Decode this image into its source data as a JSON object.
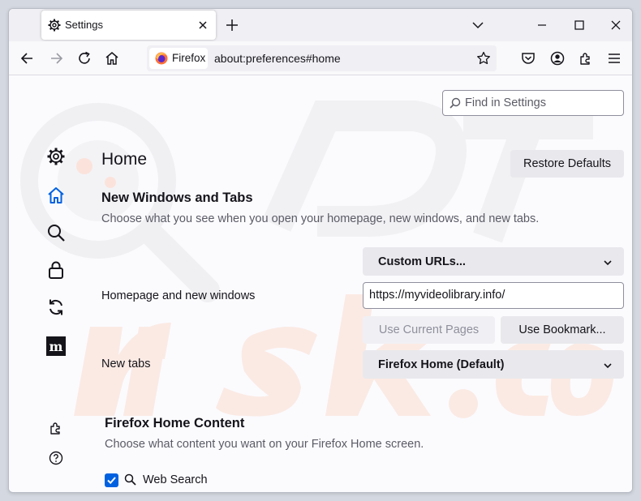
{
  "tab": {
    "title": "Settings"
  },
  "urlbar": {
    "identity_label": "Firefox",
    "url": "about:preferences#home"
  },
  "search": {
    "placeholder": "Find in Settings"
  },
  "page": {
    "title": "Home",
    "restore_defaults_label": "Restore Defaults"
  },
  "new_windows_tabs": {
    "title": "New Windows and Tabs",
    "description": "Choose what you see when you open your homepage, new windows, and new tabs.",
    "homepage_label": "Homepage and new windows",
    "homepage_select": "Custom URLs...",
    "homepage_url": "https://myvideolibrary.info/",
    "use_current_pages_label": "Use Current Pages",
    "use_bookmark_label": "Use Bookmark...",
    "new_tabs_label": "New tabs",
    "new_tabs_select": "Firefox Home (Default)"
  },
  "home_content": {
    "title": "Firefox Home Content",
    "description": "Choose what content you want on your Firefox Home screen.",
    "web_search_label": "Web Search",
    "web_search_checked": true
  },
  "sidebar": {
    "items": [
      {
        "icon": "gear-icon"
      },
      {
        "icon": "home-icon",
        "selected": true
      },
      {
        "icon": "search-icon"
      },
      {
        "icon": "lock-icon"
      },
      {
        "icon": "sync-icon"
      },
      {
        "icon": "mozilla-icon"
      }
    ],
    "footer": [
      {
        "icon": "extensions-icon"
      },
      {
        "icon": "help-icon"
      }
    ]
  },
  "colors": {
    "accent": "#0061e0",
    "button": "#e9e9ed",
    "text": "#15141a",
    "muted": "#5b5b66"
  }
}
